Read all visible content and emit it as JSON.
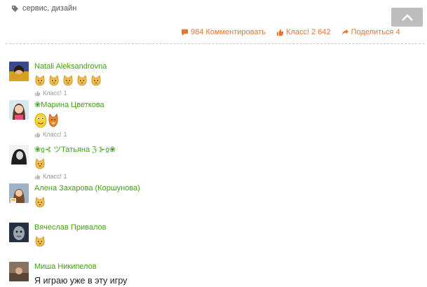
{
  "tags": {
    "text": "сервис, дизайн"
  },
  "actions": {
    "comments": "984 Комментировать",
    "likes": "Класс! 2 642",
    "share": "Поделиться 4"
  },
  "colors": {
    "accent": "#eb722e",
    "author": "#41a312",
    "muted": "#999999"
  },
  "comments": [
    {
      "author": "Natali Aleksandrovna",
      "emoji_count": 5,
      "like": "Класс! 1"
    },
    {
      "author": "❀Марина Цветкова",
      "like": "Класс! 1"
    },
    {
      "author": "❀ჲ⊰ ツТатьяна ℨ ⊱ჲ❀",
      "emoji_count": 1,
      "like": "Класс! 1"
    },
    {
      "author": "Алена Захарова (Коршунова)",
      "emoji_count": 1
    },
    {
      "author": "Вячеслав Привалов",
      "emoji_count": 1
    },
    {
      "author": "Миша Никипелов",
      "text": "Я играю уже в эту игру"
    }
  ]
}
